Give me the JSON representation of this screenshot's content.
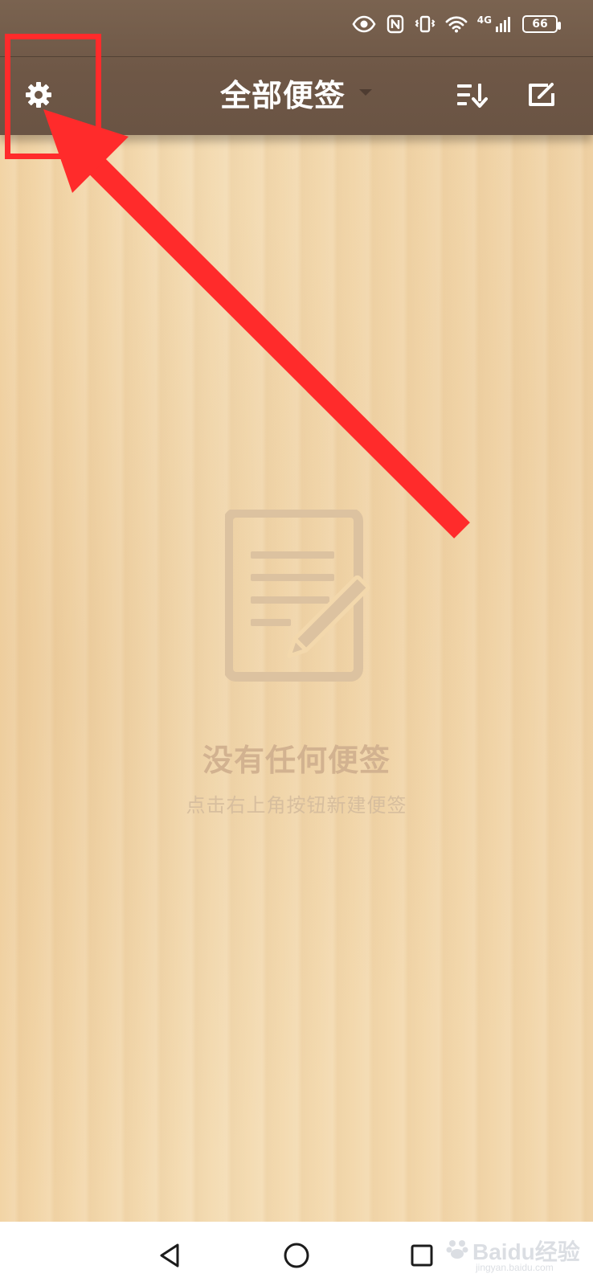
{
  "header": {
    "title": "全部便签"
  },
  "status_bar": {
    "network": "4G",
    "battery": "66"
  },
  "empty_state": {
    "title": "没有任何便签",
    "subtitle": "点击右上角按钮新建便签"
  },
  "icons": {
    "settings": "gear-icon",
    "dropdown": "caret-down-icon",
    "sort": "sort-icon",
    "new_note": "new-note-icon",
    "nav_back": "triangle-back-icon",
    "nav_home": "circle-home-icon",
    "nav_recents": "square-recents-icon"
  },
  "colors": {
    "header_brown": "#6e5746",
    "annotation_red": "#ff2b2b",
    "empty_text": "#d2b290",
    "wood": "#f3d8ac"
  },
  "watermark": {
    "text": "Baidu经验",
    "subtext": "jingyan.baidu.com"
  }
}
